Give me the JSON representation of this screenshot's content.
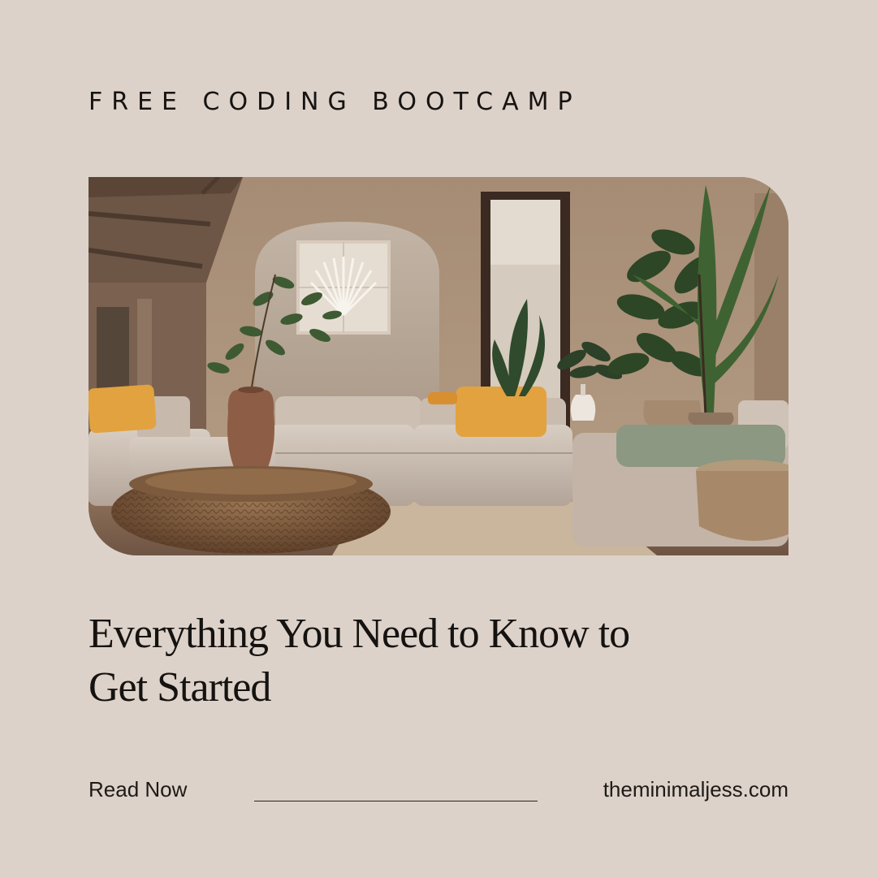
{
  "eyebrow": "FREE CODING BOOTCAMP",
  "headline": {
    "line1": "Everything You Need to Know to",
    "line2": "Get Started"
  },
  "footer": {
    "cta_label": "Read Now",
    "website": "theminimaljess.com"
  },
  "colors": {
    "background": "#dcd2c9",
    "text": "#151210",
    "cushion_accent": "#e2a23f",
    "sofa": "#c8bcb0",
    "plants": "#3a4a2a"
  },
  "hero_image": {
    "icon": "living-room-photo"
  }
}
